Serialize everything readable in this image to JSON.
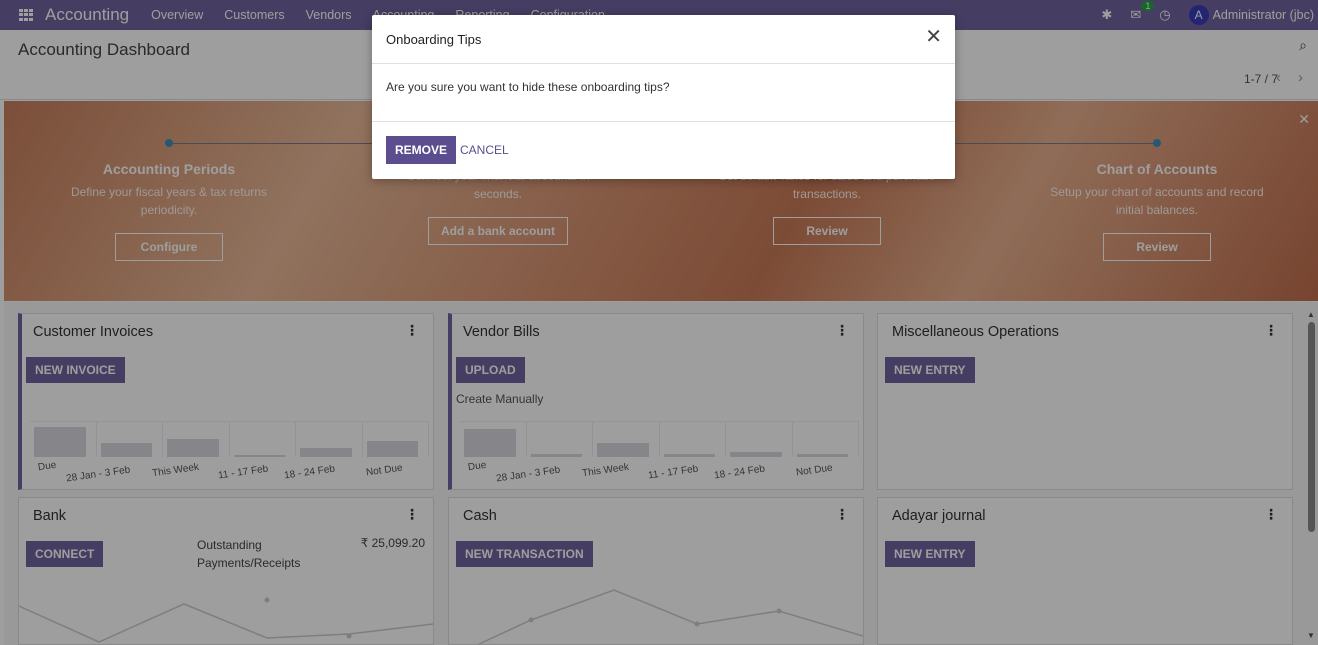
{
  "navbar": {
    "brand": "Accounting",
    "menu": [
      "Overview",
      "Customers",
      "Vendors",
      "Accounting",
      "Reporting",
      "Configuration"
    ],
    "chat_badge": "1",
    "avatar_letter": "A",
    "user": "Administrator (jbc)"
  },
  "control": {
    "title": "Accounting Dashboard",
    "pager": "1-7 / 7"
  },
  "banner": {
    "steps": [
      {
        "title": "Accounting Periods",
        "desc": "Define your fiscal years & tax returns periodicity.",
        "button": "Configure"
      },
      {
        "title": "",
        "desc": "Connect your financial accounts in seconds.",
        "button": "Add a bank account"
      },
      {
        "title": "",
        "desc": "Set default Taxes for sales and purchase transactions.",
        "button": "Review"
      },
      {
        "title": "Chart of Accounts",
        "desc": "Setup your chart of accounts and record initial balances.",
        "button": "Review"
      }
    ]
  },
  "cards": {
    "customer_invoices": {
      "title": "Customer Invoices",
      "button": "NEW INVOICE",
      "labels": [
        "Due",
        "28 Jan - 3 Feb",
        "This Week",
        "11 - 17 Feb",
        "18 - 24 Feb",
        "Not Due"
      ],
      "values": [
        30,
        14,
        18,
        1,
        9,
        16
      ]
    },
    "vendor_bills": {
      "title": "Vendor Bills",
      "button": "UPLOAD",
      "link": "Create Manually",
      "labels": [
        "Due",
        "28 Jan - 3 Feb",
        "This Week",
        "11 - 17 Feb",
        "18 - 24 Feb",
        "Not Due"
      ],
      "values": [
        28,
        3,
        14,
        3,
        5,
        3
      ]
    },
    "misc": {
      "title": "Miscellaneous Operations",
      "button": "NEW ENTRY"
    },
    "bank": {
      "title": "Bank",
      "button": "CONNECT",
      "label": "Outstanding Payments/Receipts",
      "amount": "₹ 25,099.20"
    },
    "cash": {
      "title": "Cash",
      "button": "NEW TRANSACTION"
    },
    "adayar": {
      "title": "Adayar journal",
      "button": "NEW ENTRY"
    }
  },
  "modal": {
    "title": "Onboarding Tips",
    "text": "Are you sure you want to hide these onboarding tips?",
    "remove": "REMOVE",
    "cancel": "CANCEL"
  }
}
